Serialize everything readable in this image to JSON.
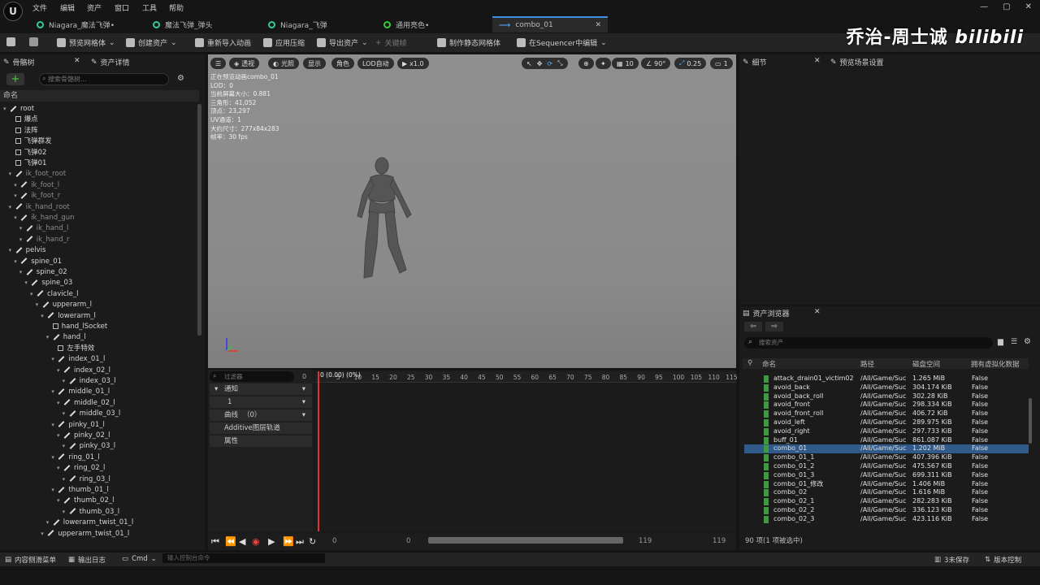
{
  "menu": [
    "文件",
    "编辑",
    "资产",
    "窗口",
    "工具",
    "帮助"
  ],
  "tabs": [
    {
      "label": "Niagara_魔法飞弹•"
    },
    {
      "label": "魔法飞弹_弹头"
    },
    {
      "label": "Niagara_飞弹"
    },
    {
      "label": "通用亮色•"
    },
    {
      "label": "combo_01",
      "close": "✕"
    }
  ],
  "toolbar": {
    "preview_mesh": "预览网格体",
    "create_asset": "创建资产",
    "reimport": "重新导入动画",
    "apply_compression": "应用压缩",
    "export_asset": "导出资产",
    "keyframe": "关键帧",
    "make_static_mesh": "制作静态网格体",
    "edit_in_sequencer": "在Sequencer中编辑"
  },
  "watermark": "乔治-周士诚",
  "watermark_logo": "bilibili",
  "left_panel": {
    "tab_skeleton": "骨骼树",
    "tab_asset_details": "资产详情",
    "search_placeholder": "搜索骨骼树...",
    "column_name": "命名"
  },
  "tree": [
    {
      "label": "root",
      "indent": 0,
      "kind": "bone"
    },
    {
      "label": "爆点",
      "indent": 1,
      "kind": "socket"
    },
    {
      "label": "法阵",
      "indent": 1,
      "kind": "socket"
    },
    {
      "label": "飞弹群发",
      "indent": 1,
      "kind": "socket"
    },
    {
      "label": "飞弹02",
      "indent": 1,
      "kind": "socket"
    },
    {
      "label": "飞弹01",
      "indent": 1,
      "kind": "socket"
    },
    {
      "label": "ik_foot_root",
      "indent": 1,
      "kind": "bone",
      "dim": true
    },
    {
      "label": "ik_foot_l",
      "indent": 2,
      "kind": "bone",
      "dim": true
    },
    {
      "label": "ik_foot_r",
      "indent": 2,
      "kind": "bone",
      "dim": true
    },
    {
      "label": "ik_hand_root",
      "indent": 1,
      "kind": "bone",
      "dim": true
    },
    {
      "label": "ik_hand_gun",
      "indent": 2,
      "kind": "bone",
      "dim": true
    },
    {
      "label": "ik_hand_l",
      "indent": 3,
      "kind": "bone",
      "dim": true
    },
    {
      "label": "ik_hand_r",
      "indent": 3,
      "kind": "bone",
      "dim": true
    },
    {
      "label": "pelvis",
      "indent": 1,
      "kind": "bone"
    },
    {
      "label": "spine_01",
      "indent": 2,
      "kind": "bone"
    },
    {
      "label": "spine_02",
      "indent": 3,
      "kind": "bone"
    },
    {
      "label": "spine_03",
      "indent": 4,
      "kind": "bone"
    },
    {
      "label": "clavicle_l",
      "indent": 5,
      "kind": "bone"
    },
    {
      "label": "upperarm_l",
      "indent": 6,
      "kind": "bone"
    },
    {
      "label": "lowerarm_l",
      "indent": 7,
      "kind": "bone"
    },
    {
      "label": "hand_lSocket",
      "indent": 8,
      "kind": "socket"
    },
    {
      "label": "hand_l",
      "indent": 8,
      "kind": "bone"
    },
    {
      "label": "左手特效",
      "indent": 9,
      "kind": "socket"
    },
    {
      "label": "index_01_l",
      "indent": 9,
      "kind": "bone"
    },
    {
      "label": "index_02_l",
      "indent": 10,
      "kind": "bone"
    },
    {
      "label": "index_03_l",
      "indent": 11,
      "kind": "bone"
    },
    {
      "label": "middle_01_l",
      "indent": 9,
      "kind": "bone"
    },
    {
      "label": "middle_02_l",
      "indent": 10,
      "kind": "bone"
    },
    {
      "label": "middle_03_l",
      "indent": 11,
      "kind": "bone"
    },
    {
      "label": "pinky_01_l",
      "indent": 9,
      "kind": "bone"
    },
    {
      "label": "pinky_02_l",
      "indent": 10,
      "kind": "bone"
    },
    {
      "label": "pinky_03_l",
      "indent": 11,
      "kind": "bone"
    },
    {
      "label": "ring_01_l",
      "indent": 9,
      "kind": "bone"
    },
    {
      "label": "ring_02_l",
      "indent": 10,
      "kind": "bone"
    },
    {
      "label": "ring_03_l",
      "indent": 11,
      "kind": "bone"
    },
    {
      "label": "thumb_01_l",
      "indent": 9,
      "kind": "bone"
    },
    {
      "label": "thumb_02_l",
      "indent": 10,
      "kind": "bone"
    },
    {
      "label": "thumb_03_l",
      "indent": 11,
      "kind": "bone"
    },
    {
      "label": "lowerarm_twist_01_l",
      "indent": 8,
      "kind": "bone"
    },
    {
      "label": "upperarm_twist_01_l",
      "indent": 7,
      "kind": "bone"
    }
  ],
  "viewport": {
    "buttons": {
      "perspective": "透视",
      "lit": "光照",
      "show": "显示",
      "character": "角色",
      "lod": "LOD自动",
      "speed": "x1.0",
      "grid": "10",
      "angle": "90°",
      "scale": "0.25",
      "camera": "1"
    },
    "info": [
      "正在预览动画combo_01",
      "LOD：0",
      "当前屏幕大小：0.881",
      "三角形：41,052",
      "顶点：23,297",
      "UV通道：1",
      "大约尺寸：277x84x283",
      "帧率：30 fps"
    ]
  },
  "timeline": {
    "filter_placeholder": "过滤器",
    "filter_count": "0",
    "notify": "通知",
    "notify_track": "1",
    "curves": "曲线",
    "curves_count": "（0）",
    "additive": "Additive图层轨道",
    "attributes": "属性",
    "frame_label": "0 (0.00) (0%)",
    "ticks": [
      "0",
      "5",
      "10",
      "15",
      "20",
      "25",
      "30",
      "35",
      "40",
      "45",
      "50",
      "55",
      "60",
      "65",
      "70",
      "75",
      "80",
      "85",
      "90",
      "95",
      "100",
      "105",
      "110",
      "115"
    ],
    "start": "0",
    "current": "0",
    "end": "119",
    "end2": "119"
  },
  "right_panels": {
    "details": "细节",
    "preview_settings": "预览场景设置",
    "asset_browser": "资产浏览器",
    "search_placeholder": "搜索资产"
  },
  "asset_columns": {
    "name": "命名",
    "path": "路径",
    "disk": "磁盘空间",
    "virtualized": "拥有虚拟化数据"
  },
  "assets": [
    {
      "name": "attack_drain01_victim02",
      "path": "/All/Game/Suc",
      "size": "1.265 MiB",
      "virt": "False"
    },
    {
      "name": "avoid_back",
      "path": "/All/Game/Suc",
      "size": "304.174 KiB",
      "virt": "False"
    },
    {
      "name": "avoid_back_roll",
      "path": "/All/Game/Suc",
      "size": "302.28 KiB",
      "virt": "False"
    },
    {
      "name": "avoid_front",
      "path": "/All/Game/Suc",
      "size": "298.334 KiB",
      "virt": "False"
    },
    {
      "name": "avoid_front_roll",
      "path": "/All/Game/Suc",
      "size": "406.72 KiB",
      "virt": "False"
    },
    {
      "name": "avoid_left",
      "path": "/All/Game/Suc",
      "size": "289.975 KiB",
      "virt": "False"
    },
    {
      "name": "avoid_right",
      "path": "/All/Game/Suc",
      "size": "297.733 KiB",
      "virt": "False"
    },
    {
      "name": "buff_01",
      "path": "/All/Game/Suc",
      "size": "861.087 KiB",
      "virt": "False"
    },
    {
      "name": "combo_01",
      "path": "/All/Game/Suc",
      "size": "1.202 MiB",
      "virt": "False",
      "selected": true
    },
    {
      "name": "combo_01_1",
      "path": "/All/Game/Suc",
      "size": "407.396 KiB",
      "virt": "False"
    },
    {
      "name": "combo_01_2",
      "path": "/All/Game/Suc",
      "size": "475.567 KiB",
      "virt": "False"
    },
    {
      "name": "combo_01_3",
      "path": "/All/Game/Suc",
      "size": "699.311 KiB",
      "virt": "False"
    },
    {
      "name": "combo_01_修改",
      "path": "/All/Game/Suc",
      "size": "1.406 MiB",
      "virt": "False"
    },
    {
      "name": "combo_02",
      "path": "/All/Game/Suc",
      "size": "1.616 MiB",
      "virt": "False"
    },
    {
      "name": "combo_02_1",
      "path": "/All/Game/Suc",
      "size": "282.283 KiB",
      "virt": "False"
    },
    {
      "name": "combo_02_2",
      "path": "/All/Game/Suc",
      "size": "336.123 KiB",
      "virt": "False"
    },
    {
      "name": "combo_02_3",
      "path": "/All/Game/Suc",
      "size": "423.116 KiB",
      "virt": "False"
    }
  ],
  "browser_footer": "90 项(1 项被选中)",
  "statusbar": {
    "content_drawer": "内容侧滑菜单",
    "output_log": "输出日志",
    "cmd": "Cmd",
    "console_placeholder": "输入控制台命令",
    "unsaved": "3未保存",
    "source_control": "版本控制"
  }
}
